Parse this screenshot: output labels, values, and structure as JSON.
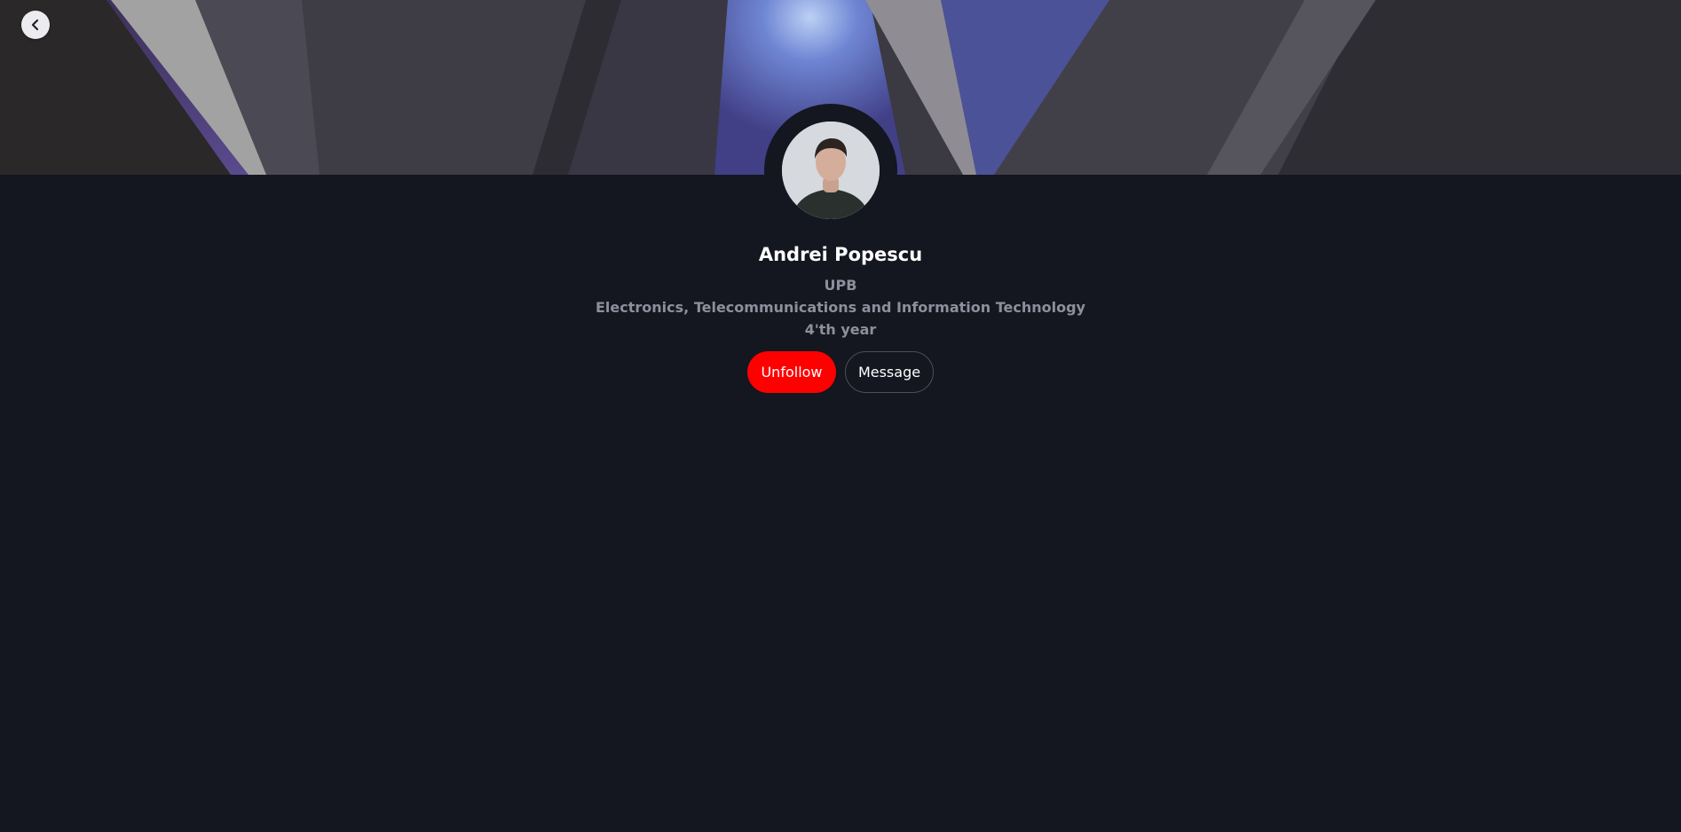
{
  "profile": {
    "name": "Andrei Popescu",
    "university": "UPB",
    "faculty": "Electronics, Telecommunications and Information Technology",
    "year": "4'th year"
  },
  "actions": {
    "unfollow_label": "Unfollow",
    "message_label": "Message"
  },
  "icons": {
    "back": "chevron-left-icon"
  },
  "colors": {
    "background": "#141620",
    "unfollow": "#ff0000",
    "name_text": "#ffffff",
    "secondary_text": "#8d909c"
  }
}
